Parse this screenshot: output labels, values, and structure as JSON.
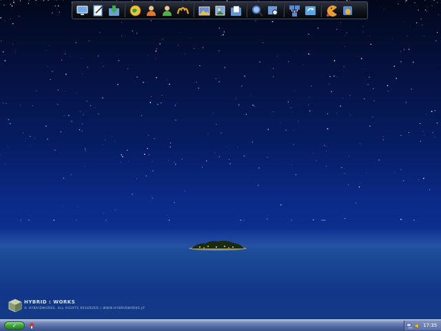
{
  "desktop": {
    "wallpaper": "night-sky-island",
    "logo": {
      "title": "HYBRID : WORKS",
      "copyright": "© HYBRIDWORKS. ALL RIGHTS RESERVED  |  WWW.HYBRIDWORKS.JP"
    }
  },
  "toolbar": {
    "groups": [
      [
        {
          "name": "monitor-icon",
          "color": "#6fa8e8"
        },
        {
          "name": "edit-document-icon",
          "color": "#4a8ad8"
        },
        {
          "name": "download-folder-icon",
          "color": "#3fae4a"
        }
      ],
      [
        {
          "name": "globe-icon",
          "color": "#e8c23a"
        },
        {
          "name": "user-orange-icon",
          "color": "#e07a2a"
        },
        {
          "name": "user-green-icon",
          "color": "#4fb24a"
        },
        {
          "name": "messenger-icon",
          "color": "#e6a020"
        }
      ],
      [
        {
          "name": "pictures-icon",
          "color": "#6a8ed0"
        },
        {
          "name": "gallery-icon",
          "color": "#7aa8e0"
        },
        {
          "name": "photo-folder-icon",
          "color": "#5a9ad8"
        }
      ],
      [
        {
          "name": "search-icon",
          "color": "#4a78c8"
        },
        {
          "name": "find-image-icon",
          "color": "#6a98d8"
        }
      ],
      [
        {
          "name": "network-icon",
          "color": "#5a88d0"
        },
        {
          "name": "sync-icon",
          "color": "#58a8e0"
        }
      ],
      [
        {
          "name": "pacman-icon",
          "color": "#e8a030"
        },
        {
          "name": "apps-icon",
          "color": "#e8b040"
        }
      ]
    ]
  },
  "taskbar": {
    "start_label": "✓",
    "quick_launch": [
      {
        "name": "quicklaunch-icon",
        "color": "#d03a2a"
      }
    ],
    "tray": {
      "icons": [
        {
          "name": "network-tray-icon",
          "color": "#c8d8f0"
        },
        {
          "name": "volume-tray-icon",
          "color": "#f0c040"
        }
      ],
      "clock": "17:35"
    }
  }
}
